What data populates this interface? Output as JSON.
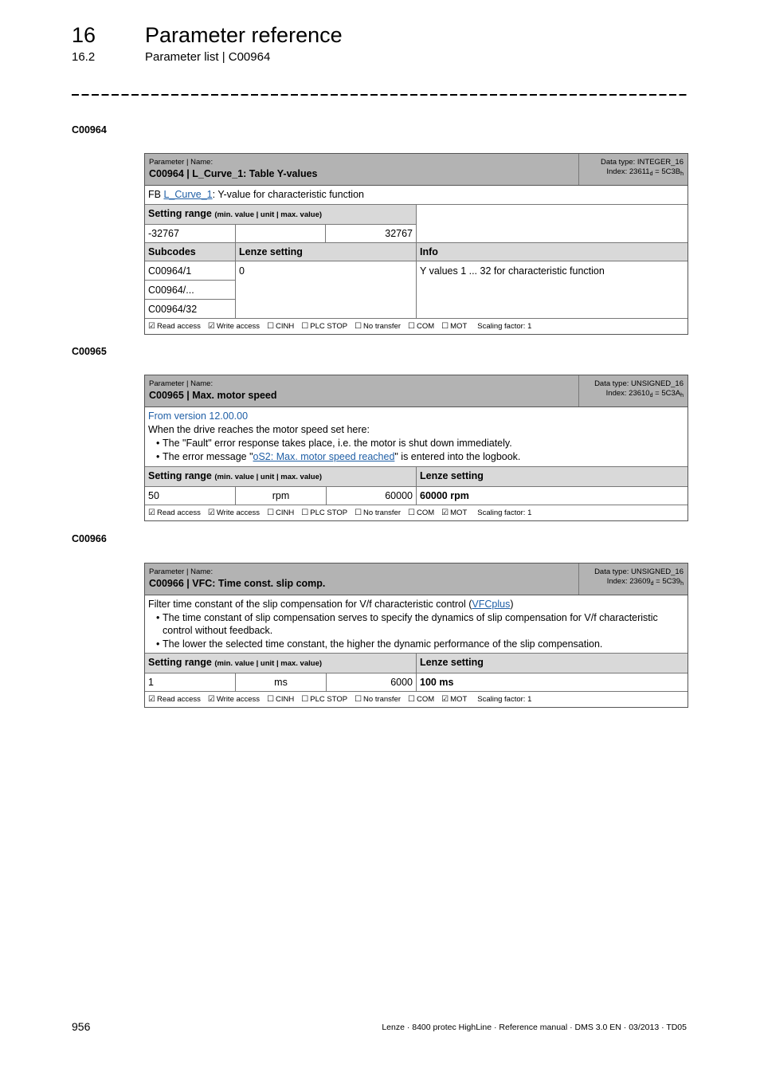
{
  "header": {
    "chapter_number": "16",
    "chapter_title": "Parameter reference",
    "section_number": "16.2",
    "section_title": "Parameter list | C00964"
  },
  "parameters": [
    {
      "heading": "C00964",
      "header_label": "Parameter | Name:",
      "name": "C00964 | L_Curve_1: Table Y-values",
      "data_type": "Data type: INTEGER_16",
      "index_prefix": "Index: 23611",
      "index_d": "d",
      "index_mid": " = 5C3B",
      "index_h": "h",
      "description_prefix": "FB ",
      "description_link": "L_Curve_1",
      "description_suffix": ": Y-value for characteristic function",
      "setting_range_label": "Setting range",
      "setting_range_hint": "(min. value | unit | max. value)",
      "min": "-32767",
      "unit": "",
      "max": "32767",
      "subcodes_header": "Subcodes",
      "lenze_header": "Lenze setting",
      "info_header": "Info",
      "subcodes": [
        "C00964/1",
        "C00964/...",
        "C00964/32"
      ],
      "lenze_value": "0",
      "info_value": "Y values 1 ... 32 for characteristic function",
      "flags": [
        {
          "label": "Read access",
          "checked": true
        },
        {
          "label": "Write access",
          "checked": true
        },
        {
          "label": "CINH",
          "checked": false
        },
        {
          "label": "PLC STOP",
          "checked": false
        },
        {
          "label": "No transfer",
          "checked": false
        },
        {
          "label": "COM",
          "checked": false
        },
        {
          "label": "MOT",
          "checked": false
        }
      ],
      "scaling": "Scaling factor: 1"
    },
    {
      "heading": "C00965",
      "header_label": "Parameter | Name:",
      "name": "C00965 | Max. motor speed",
      "data_type": "Data type: UNSIGNED_16",
      "index_prefix": "Index: 23610",
      "index_d": "d",
      "index_mid": " = 5C3A",
      "index_h": "h",
      "version_note": "From version 12.00.00",
      "description_intro": "When the drive reaches the motor speed set here:",
      "bullet1": "The \"Fault\" error response takes place, i.e. the motor is shut down immediately.",
      "bullet2_prefix": "The error message \"",
      "bullet2_link": "oS2: Max. motor speed reached",
      "bullet2_suffix": "\" is entered into the logbook.",
      "setting_range_label": "Setting range",
      "setting_range_hint": "(min. value | unit | max. value)",
      "lenze_header": "Lenze setting",
      "min": "50",
      "unit": "rpm",
      "max": "60000",
      "lenze_value": "60000 rpm",
      "flags": [
        {
          "label": "Read access",
          "checked": true
        },
        {
          "label": "Write access",
          "checked": true
        },
        {
          "label": "CINH",
          "checked": false
        },
        {
          "label": "PLC STOP",
          "checked": false
        },
        {
          "label": "No transfer",
          "checked": false
        },
        {
          "label": "COM",
          "checked": false
        },
        {
          "label": "MOT",
          "checked": true
        }
      ],
      "scaling": "Scaling factor: 1"
    },
    {
      "heading": "C00966",
      "header_label": "Parameter | Name:",
      "name": "C00966 | VFC: Time const. slip comp.",
      "data_type": "Data type: UNSIGNED_16",
      "index_prefix": "Index: 23609",
      "index_d": "d",
      "index_mid": " = 5C39",
      "index_h": "h",
      "description_prefix": "Filter time constant of the slip compensation for V/f characteristic control (",
      "description_link": "VFCplus",
      "description_suffix": ")",
      "bullet1": "The time constant of slip compensation serves to specify the dynamics of slip compensation for V/f characteristic control without feedback.",
      "bullet2": "The lower the selected time constant, the higher the dynamic performance of the slip compensation.",
      "setting_range_label": "Setting range",
      "setting_range_hint": "(min. value | unit | max. value)",
      "lenze_header": "Lenze setting",
      "min": "1",
      "unit": "ms",
      "max": "6000",
      "lenze_value": "100 ms",
      "flags": [
        {
          "label": "Read access",
          "checked": true
        },
        {
          "label": "Write access",
          "checked": true
        },
        {
          "label": "CINH",
          "checked": false
        },
        {
          "label": "PLC STOP",
          "checked": false
        },
        {
          "label": "No transfer",
          "checked": false
        },
        {
          "label": "COM",
          "checked": false
        },
        {
          "label": "MOT",
          "checked": true
        }
      ],
      "scaling": "Scaling factor: 1"
    }
  ],
  "footer": {
    "page_number": "956",
    "document_info": "Lenze · 8400 protec HighLine · Reference manual · DMS 3.0 EN · 03/2013 · TD05"
  }
}
